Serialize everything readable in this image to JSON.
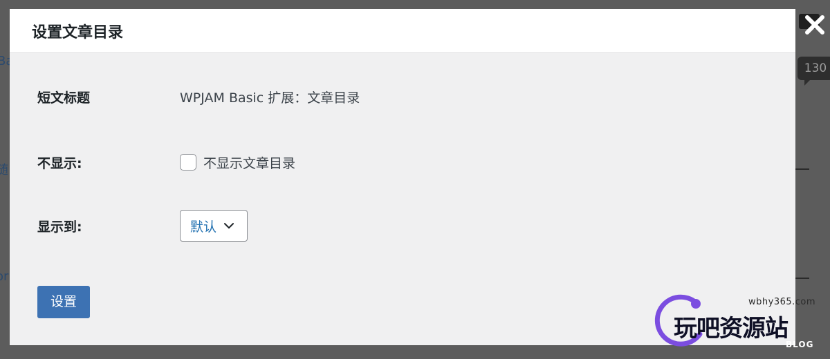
{
  "modal": {
    "title": "设置文章目录",
    "fields": {
      "shortcode_label": "短文标题",
      "shortcode_value": "WPJAM Basic 扩展：文章目录",
      "hide_label": "不显示:",
      "hide_checkbox_label": "不显示文章目录",
      "hide_checked": false,
      "position_label": "显示到:",
      "position_selected": "默认"
    },
    "submit_label": "设置"
  },
  "background": {
    "badge_count": "130",
    "fragments": [
      "Ba",
      "随",
      "or"
    ]
  },
  "watermark": {
    "url": "wbhy365.com",
    "brand": "玩吧资源站",
    "sub": "BLOG"
  },
  "colors": {
    "accent": "#2271b1",
    "button": "#3d72b3",
    "modal_body": "#f0f0f1",
    "watermark_purple": "#7b4de0"
  }
}
